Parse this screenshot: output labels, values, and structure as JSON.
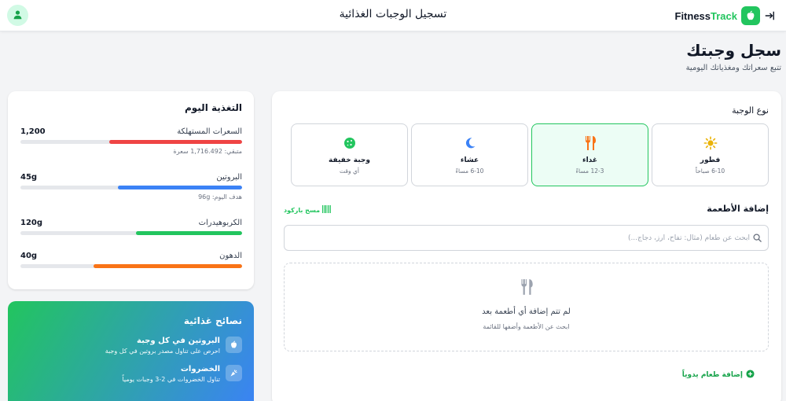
{
  "header": {
    "title": "تسجيل الوجبات الغذائية",
    "brand": {
      "name_primary": "Fitness",
      "name_accent": "Track"
    }
  },
  "page": {
    "title": "سجل وجبتك",
    "subtitle": "تتبع سعراتك ومغذياتك اليومية"
  },
  "nutrition": {
    "title": "التغذية اليوم",
    "metrics": [
      {
        "label": "السعرات المستهلكة",
        "value": "1,200",
        "note": "متبقي: 1,716.492 سعرة",
        "progress": 0.6,
        "color": "#ef4444"
      },
      {
        "label": "البروتين",
        "value": "45g",
        "note": "هدف اليوم: 96g",
        "progress": 0.56,
        "color": "#3b82f6"
      },
      {
        "label": "الكربوهيدرات",
        "value": "120g",
        "note": "",
        "progress": 0.48,
        "color": "#22c55e"
      },
      {
        "label": "الدهون",
        "value": "40g",
        "note": "",
        "progress": 0.67,
        "color": "#f97316"
      }
    ]
  },
  "tips": {
    "title": "نصائح غذائية",
    "items": [
      {
        "title": "البروتين في كل وجبة",
        "text": "احرص على تناول مصدر بروتين في كل وجبة",
        "icon": "apple-icon"
      },
      {
        "title": "الخضروات",
        "text": "تناول الخضروات في 2-3 وجبات يومياً",
        "icon": "carrot-icon"
      }
    ]
  },
  "meal": {
    "type_label": "نوع الوجبة",
    "types": [
      {
        "name": "فطور",
        "time": "6-10 صباحاً",
        "icon": "sun-icon",
        "color": "#eab308",
        "selected": false
      },
      {
        "name": "غداء",
        "time": "12-3 مساءً",
        "icon": "utensils-icon",
        "color": "#f97316",
        "selected": true
      },
      {
        "name": "عشاء",
        "time": "6-10 مساءً",
        "icon": "moon-icon",
        "color": "#3b82f6",
        "selected": false
      },
      {
        "name": "وجبة خفيفة",
        "time": "أي وقت",
        "icon": "cookie-icon",
        "color": "#22c55e",
        "selected": false
      }
    ],
    "add_foods_title": "إضافة الأطعمة",
    "barcode_label": "مسح باركود",
    "search_placeholder": "ابحث عن طعام (مثال: تفاح، أرز، دجاج...)",
    "empty_title": "لم تتم إضافة أي أطعمة بعد",
    "empty_text": "ابحث عن الأطعمة وأضفها للقائمة",
    "manual_add_label": "إضافة طعام يدوياً"
  }
}
